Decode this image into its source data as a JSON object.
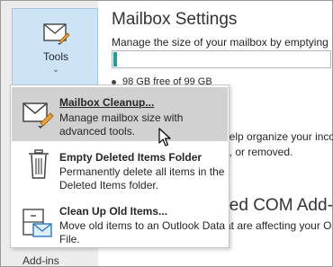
{
  "sidebar": {
    "tools_label": "Tools",
    "tools_chevron": "⌄",
    "addins_label": "Add-ins"
  },
  "mailbox": {
    "title": "Mailbox Settings",
    "description": "Manage the size of your mailbox by emptying",
    "free_space_text": "98 GB free of 99 GB",
    "used_fraction": 0.01,
    "bar_color": "#1aa0a0"
  },
  "background": {
    "heading_fragment": "s",
    "line1": "help organize your inco",
    "line2": "d, or removed.",
    "heading2": "bled COM Add-",
    "line3": "that are affecting your O"
  },
  "menu": {
    "items": [
      {
        "title_underline": "M",
        "title": "ailbox Cleanup...",
        "description": "Manage mailbox size with advanced tools.",
        "icon": "mailbox-cleanup-icon"
      },
      {
        "title": "Empty Deleted Items Folder",
        "description": "Permanently delete all items in the Deleted Items folder.",
        "icon": "trash-can-icon"
      },
      {
        "title": "Clean Up Old Items...",
        "description": "Move old items to an Outlook Data File.",
        "icon": "archive-cabinet-icon"
      }
    ]
  }
}
